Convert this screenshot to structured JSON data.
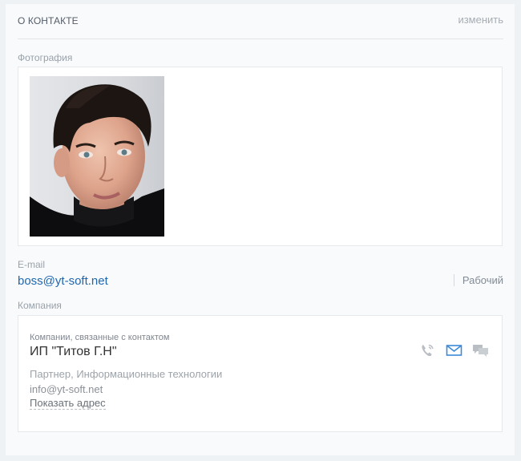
{
  "header": {
    "title": "О КОНТАКТЕ",
    "edit_label": "изменить"
  },
  "photo": {
    "label": "Фотография"
  },
  "email": {
    "label": "E-mail",
    "value": "boss@yt-soft.net",
    "type": "Рабочий"
  },
  "company": {
    "label": "Компания",
    "caption": "Компании, связанные с контактом",
    "name": "ИП \"Титов Г.Н\"",
    "description": "Партнер, Информационные технологии",
    "email": "info@yt-soft.net",
    "show_address": "Показать адрес",
    "actions": [
      "phone-icon",
      "mail-icon",
      "chat-icon"
    ]
  },
  "colors": {
    "link": "#2067b0",
    "accent_icon": "#3b8ad9",
    "muted_icon": "#b8bec4"
  }
}
